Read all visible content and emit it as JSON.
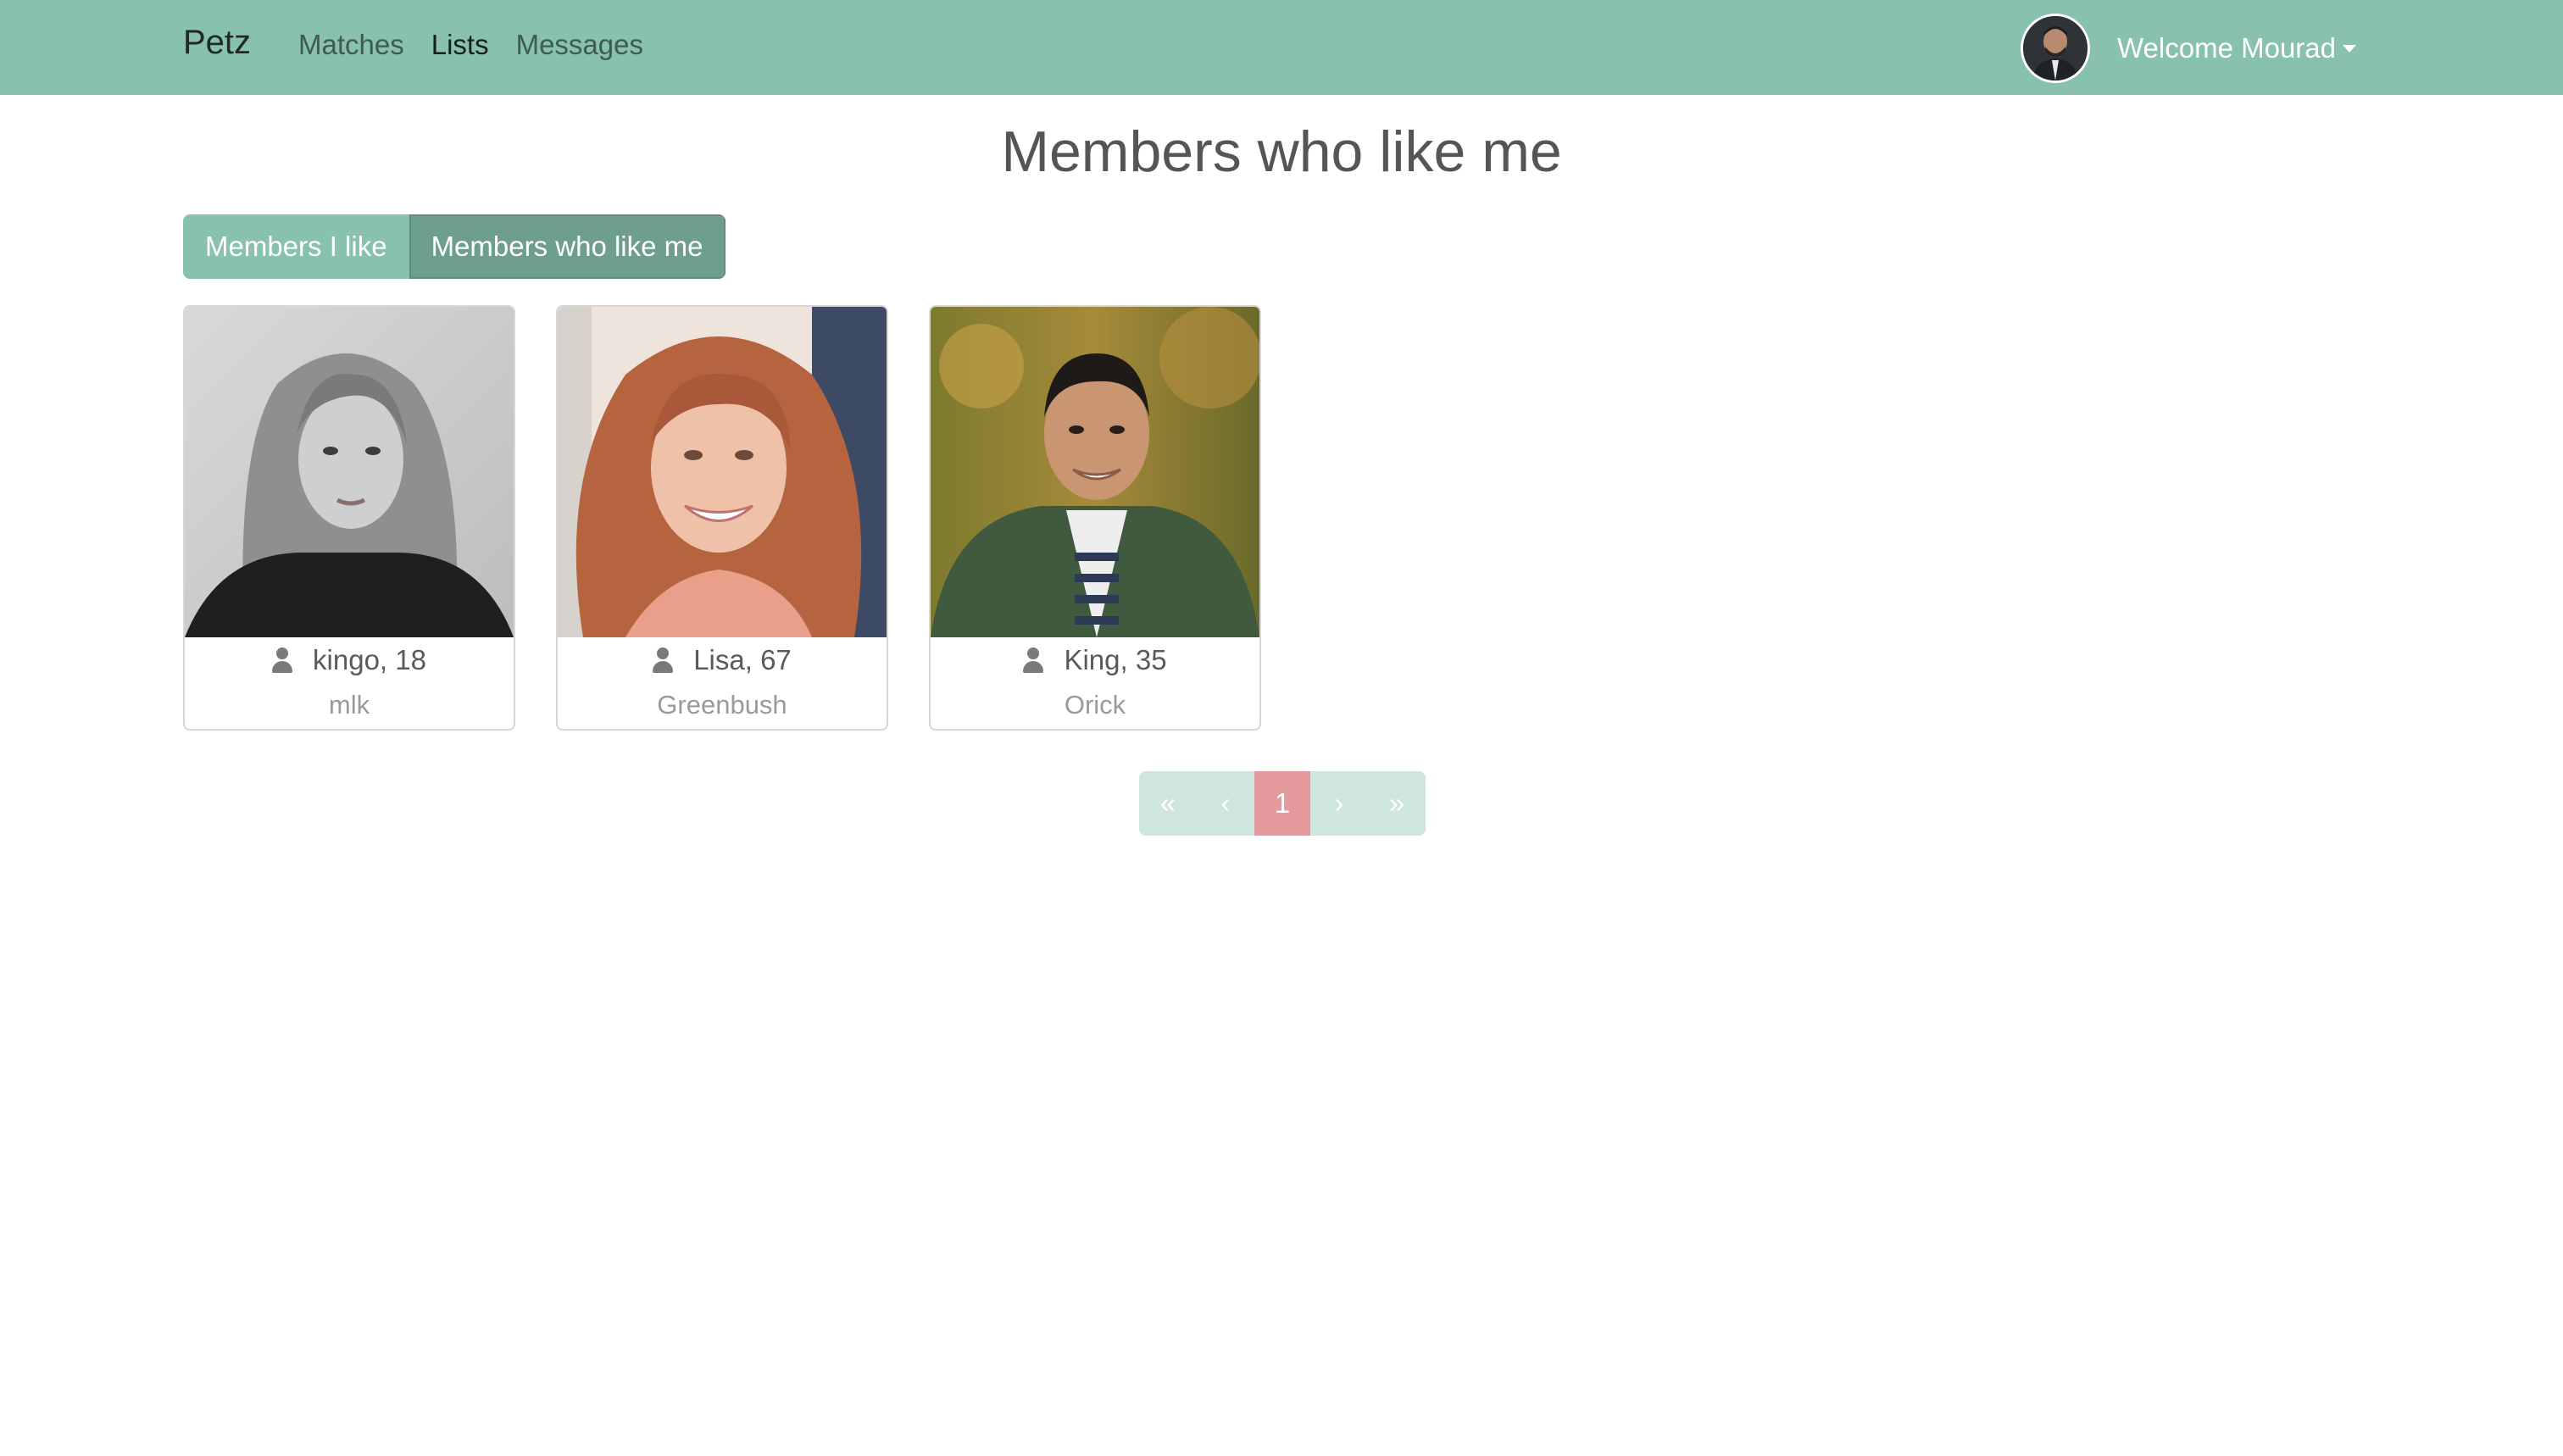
{
  "navbar": {
    "brand": "Petz",
    "links": [
      {
        "label": "Matches",
        "active": false
      },
      {
        "label": "Lists",
        "active": true
      },
      {
        "label": "Messages",
        "active": false
      }
    ],
    "welcome": "Welcome Mourad"
  },
  "page": {
    "title": "Members who like me"
  },
  "toggle": {
    "members_i_like": "Members I like",
    "members_who_like_me": "Members who like me",
    "selected": "Members who like me"
  },
  "members": [
    {
      "name_age": "kingo, 18",
      "city": "mlk"
    },
    {
      "name_age": "Lisa, 67",
      "city": "Greenbush"
    },
    {
      "name_age": "King, 35",
      "city": "Orick"
    }
  ],
  "pagination": {
    "first": "«",
    "prev": "‹",
    "current": "1",
    "next": "›",
    "last": "»"
  },
  "colors": {
    "navbar": "#88c1ad",
    "toggle_active": "#6e9e8d",
    "page_current": "#e4999c",
    "page_disabled": "#cfe6de"
  },
  "icons": {
    "member_icon": "user-icon"
  }
}
